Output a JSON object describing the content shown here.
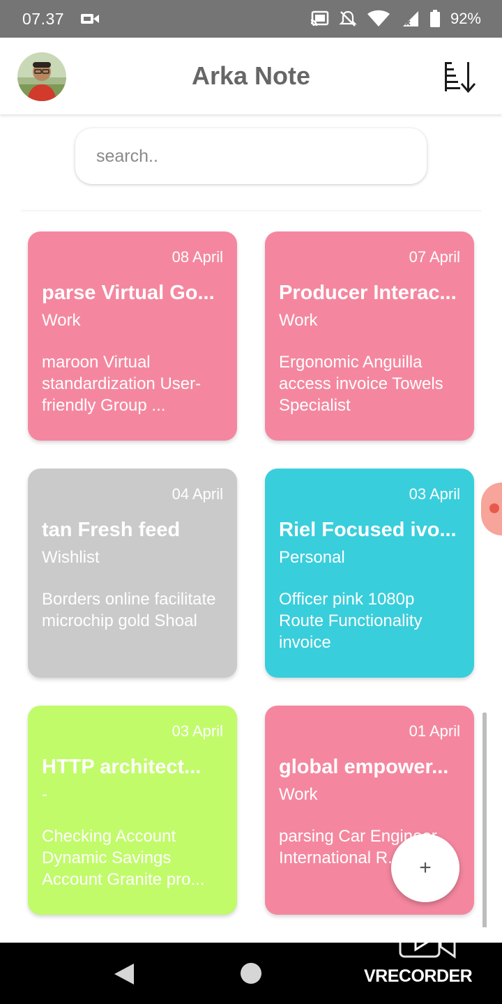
{
  "status_bar": {
    "time": "07.37",
    "battery": "92%",
    "icons": [
      "video-recording-icon",
      "cast-icon",
      "mute-icon",
      "wifi-icon",
      "signal-icon",
      "battery-icon"
    ]
  },
  "header": {
    "title": "Arka Note",
    "avatar_icon": "profile-avatar",
    "sort_icon": "sort-descending-icon"
  },
  "search": {
    "placeholder": "search..",
    "value": ""
  },
  "notes": [
    {
      "date": "08 April",
      "title": "parse Virtual Go...",
      "category": "Work",
      "body": "maroon Virtual standardization User-friendly Group ...",
      "color": "#f4879f"
    },
    {
      "date": "07 April",
      "title": "Producer Interac...",
      "category": "Work",
      "body": "Ergonomic Anguilla access invoice Towels Specialist",
      "color": "#f4879f"
    },
    {
      "date": "04 April",
      "title": "tan Fresh feed",
      "category": "Wishlist",
      "body": "Borders online facilitate microchip gold Shoal",
      "color": "#cacaca"
    },
    {
      "date": "03 April",
      "title": "Riel Focused ivo...",
      "category": "Personal",
      "body": "Officer pink 1080p Route Functionality invoice",
      "color": "#39cedb"
    },
    {
      "date": "03 April",
      "title": "HTTP architect...",
      "category": "-",
      "body": "Checking Account Dynamic Savings Account Granite pro...",
      "color": "#c1fb6a"
    },
    {
      "date": "01 April",
      "title": "global empower...",
      "category": "Work",
      "body": "parsing Car Engineer International R... holistic",
      "color": "#f4879f"
    }
  ],
  "fab": {
    "label": "+"
  },
  "watermark": {
    "text": "VRECORDER"
  },
  "nav": {
    "back_icon": "back-triangle-icon",
    "home_icon": "home-circle-icon"
  }
}
